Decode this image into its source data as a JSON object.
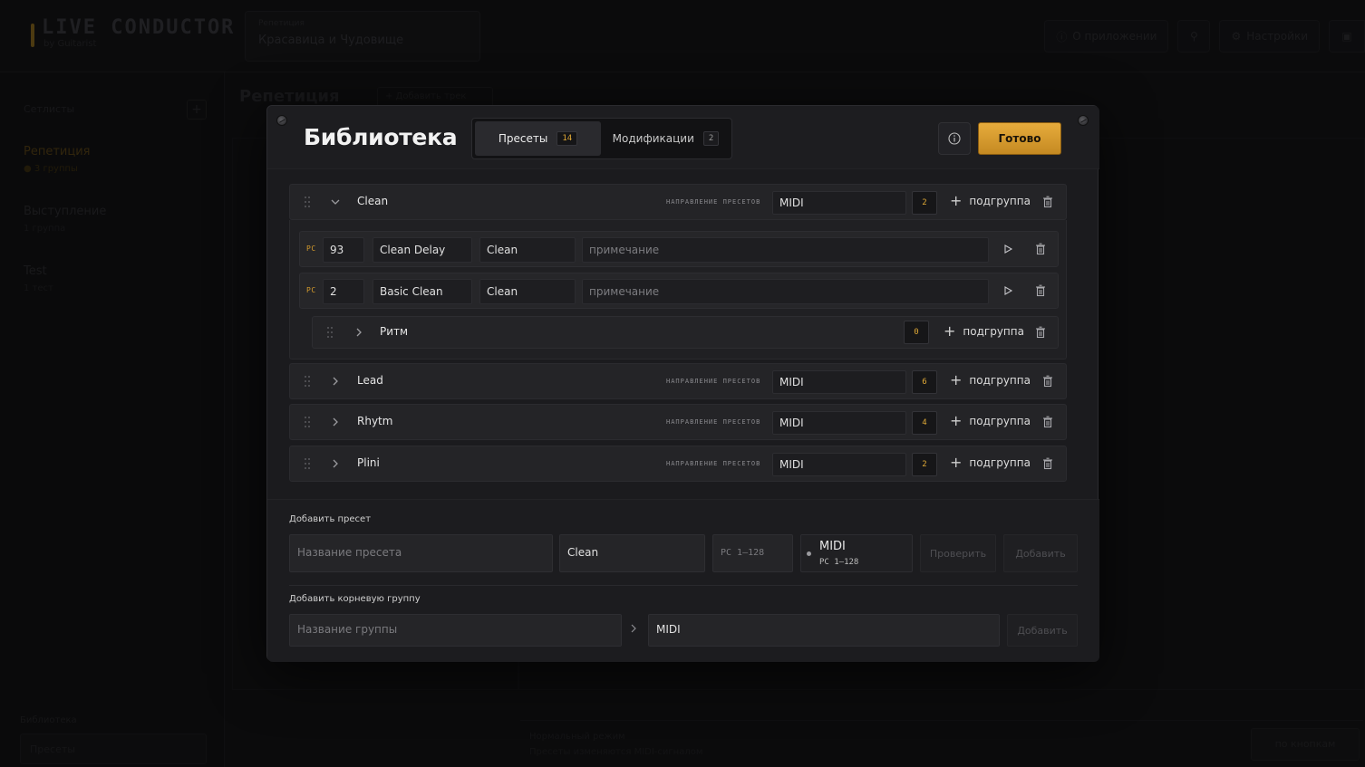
{
  "app": {
    "logo_title": "LIVE CONDUCTOR",
    "logo_sub": "by Guitarist",
    "session_label": "Репетиция",
    "session_value": "Красавица и Чудовище",
    "top_buttons": [
      "О приложении",
      "Настройки"
    ]
  },
  "sidebar": {
    "heading": "Сетлисты",
    "items": [
      {
        "title": "Репетиция",
        "sub": "● 3 группы"
      },
      {
        "title": "Выступление",
        "sub": "1 группа"
      },
      {
        "title": "Test",
        "sub": "1 тест"
      }
    ],
    "library_label": "Библиотека",
    "search_placeholder": "Пресеты"
  },
  "main": {
    "title": "Репетиция",
    "add_song": "+ Добавить трек",
    "status_a": "Нормальный режим",
    "status_b": "Пресеты изменяются MIDI-сигналом",
    "footer_button": "по кнопкам"
  },
  "modal": {
    "title": "Библиотека",
    "done_label": "Готово",
    "tabs": [
      {
        "label": "Пресеты",
        "count": "14"
      },
      {
        "label": "Модификации",
        "count": "2"
      }
    ],
    "direction_label": "НАПРАВЛЕНИЕ ПРЕСЕТОВ",
    "subgroup_label": "подгруппа",
    "groups": [
      {
        "name": "Clean",
        "direction": "MIDI",
        "count": "2",
        "expanded": true
      },
      {
        "name": "Lead",
        "direction": "MIDI",
        "count": "6"
      },
      {
        "name": "Rhytm",
        "direction": "MIDI",
        "count": "4"
      },
      {
        "name": "Plini",
        "direction": "MIDI",
        "count": "2"
      }
    ],
    "presets": [
      {
        "tag": "PC",
        "number": "93",
        "name": "Clean Delay",
        "group": "Clean",
        "note_placeholder": "примечание"
      },
      {
        "tag": "PC",
        "number": "2",
        "name": "Basic Clean",
        "group": "Clean",
        "note_placeholder": "примечание"
      }
    ],
    "subgroup": {
      "name": "Ритм",
      "count": "0"
    },
    "add_preset": {
      "label": "Добавить пресет",
      "name_placeholder": "Название пресета",
      "group_value": "Clean",
      "pc_placeholder": "PC 1–128",
      "midi_name": "MIDI",
      "midi_range": "PC 1–128",
      "check_label": "Проверить",
      "add_label": "Добавить"
    },
    "add_group": {
      "label": "Добавить корневую группу",
      "name_placeholder": "Название группы",
      "direction_value": "MIDI",
      "add_label": "Добавить"
    }
  },
  "colors": {
    "accent": "#e0a936",
    "done_button": "#e6ab3c"
  }
}
